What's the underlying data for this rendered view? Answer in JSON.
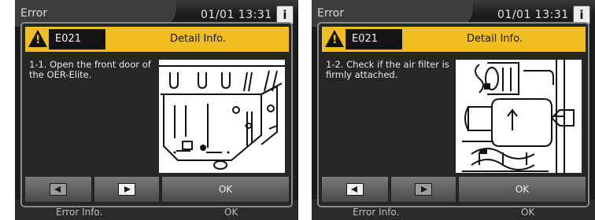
{
  "screens": [
    {
      "window_title": "Error",
      "clock": "01/01 13:31",
      "info_button": "i",
      "under_buttons": [
        "Error Info.",
        "OK"
      ],
      "dialog": {
        "error_code": "E021",
        "title": "Detail Info.",
        "message": "1-1. Open the front door of the OER-Elite.",
        "illustration": "front-door-open-diagram",
        "prev_enabled": false,
        "next_enabled": true,
        "ok_label": "OK"
      }
    },
    {
      "window_title": "Error",
      "clock": "01/01 13:31",
      "info_button": "i",
      "under_buttons": [
        "Error Info.",
        "OK"
      ],
      "dialog": {
        "error_code": "E021",
        "title": "Detail Info.",
        "message": "1-2. Check if the air filter is firmly attached.",
        "illustration": "air-filter-attached-diagram",
        "prev_enabled": true,
        "next_enabled": false,
        "ok_label": "OK"
      }
    }
  ],
  "colors": {
    "header_accent": "#f0be20",
    "background": "#1b1b1b"
  }
}
